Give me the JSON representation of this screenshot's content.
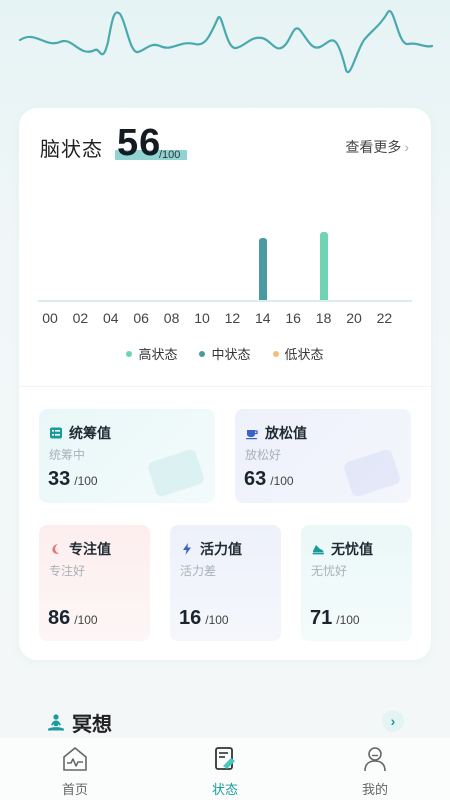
{
  "brain": {
    "title": "脑状态",
    "score": "56",
    "score_max": "/100",
    "more_label": "查看更多"
  },
  "chart_data": {
    "type": "bar",
    "x": [
      "00",
      "02",
      "04",
      "06",
      "08",
      "10",
      "12",
      "14",
      "16",
      "18",
      "20",
      "22"
    ],
    "series": [
      {
        "name": "中状态",
        "color": "#4a9aa2",
        "points": [
          {
            "x": 14,
            "y": 56
          }
        ]
      },
      {
        "name": "高状态",
        "color": "#6fd3b4",
        "points": [
          {
            "x": 18,
            "y": 62
          }
        ]
      }
    ],
    "xlim": [
      0,
      24
    ],
    "ylim": [
      0,
      100
    ]
  },
  "legend": [
    {
      "label": "高状态",
      "color": "#6fd3b4"
    },
    {
      "label": "中状态",
      "color": "#4a9aa2"
    },
    {
      "label": "低状态",
      "color": "#f0c07a"
    }
  ],
  "tiles": {
    "tongchou": {
      "name": "统筹值",
      "status": "统筹中",
      "value": "33",
      "max": "/100",
      "icon": "list-icon",
      "accent": "#1a9b9b"
    },
    "fangsong": {
      "name": "放松值",
      "status": "放松好",
      "value": "63",
      "max": "/100",
      "icon": "cup-icon",
      "accent": "#3a62c8"
    },
    "zhuanzhu": {
      "name": "专注值",
      "status": "专注好",
      "value": "86",
      "max": "/100",
      "icon": "moon-icon",
      "accent": "#e07a7a"
    },
    "huoli": {
      "name": "活力值",
      "status": "活力差",
      "value": "16",
      "max": "/100",
      "icon": "lightning-icon",
      "accent": "#3a62c8"
    },
    "wuyou": {
      "name": "无忧值",
      "status": "无忧好",
      "value": "71",
      "max": "/100",
      "icon": "shoe-icon",
      "accent": "#1a9b9b"
    }
  },
  "meditation": {
    "title": "冥想",
    "icon": "meditation-icon"
  },
  "tabbar": {
    "items": [
      {
        "label": "首页",
        "icon": "home-icon"
      },
      {
        "label": "状态",
        "icon": "status-report-icon"
      },
      {
        "label": "我的",
        "icon": "profile-icon"
      }
    ],
    "active": "状态"
  }
}
